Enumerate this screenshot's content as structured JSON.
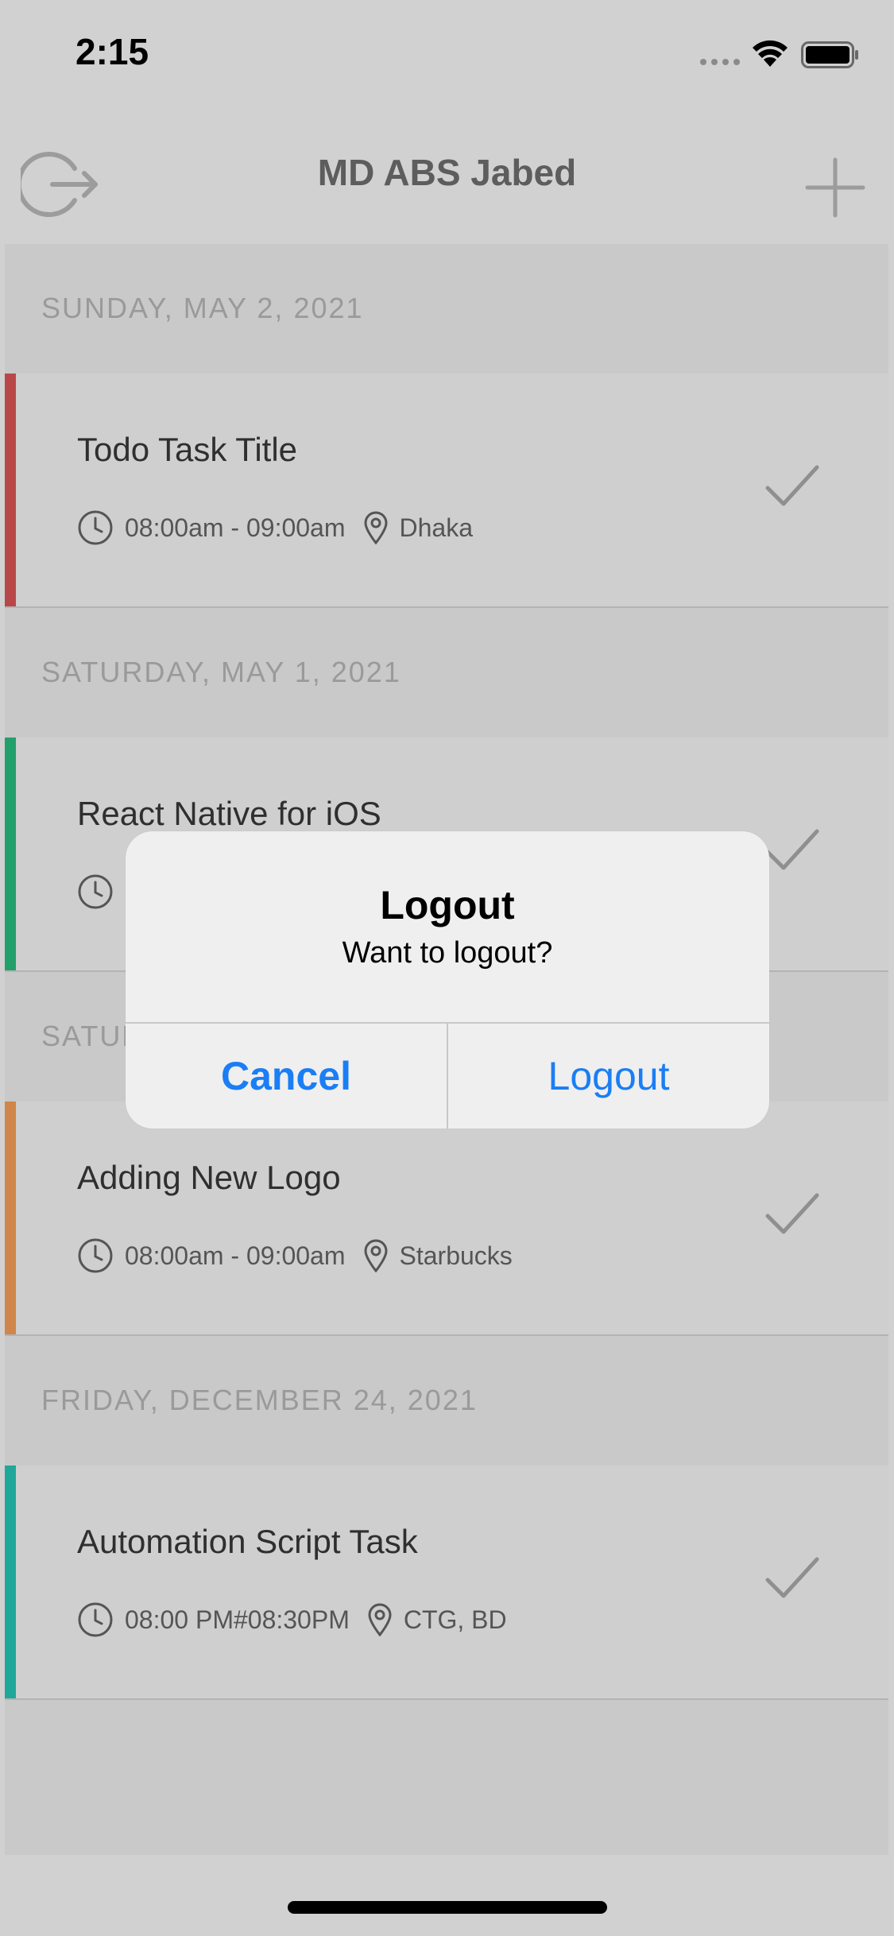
{
  "status_bar": {
    "time": "2:15"
  },
  "header": {
    "title": "MD ABS Jabed"
  },
  "sections": [
    {
      "date": "SUNDAY, MAY 2, 2021",
      "task": {
        "title": "Todo Task Title",
        "time": "08:00am - 09:00am",
        "location": "Dhaka",
        "color": "#b84848"
      }
    },
    {
      "date": "SATURDAY, MAY 1, 2021",
      "task": {
        "title": "React Native for iOS",
        "time": "",
        "location": "",
        "color": "#22a06b"
      }
    },
    {
      "date": "SATUR",
      "task": {
        "title": "Adding New Logo",
        "time": "08:00am - 09:00am",
        "location": "Starbucks",
        "color": "#d0864a"
      }
    },
    {
      "date": "FRIDAY, DECEMBER 24, 2021",
      "task": {
        "title": "Automation Script Task",
        "time": "08:00 PM#08:30PM",
        "location": "CTG, BD",
        "color": "#1fa89a"
      }
    }
  ],
  "dialog": {
    "title": "Logout",
    "message": "Want to logout?",
    "cancel_label": "Cancel",
    "confirm_label": "Logout",
    "button_color": "#1a7ef5"
  },
  "colors": {
    "background": "#d1d1d1",
    "title_text": "#5d5d5d"
  }
}
